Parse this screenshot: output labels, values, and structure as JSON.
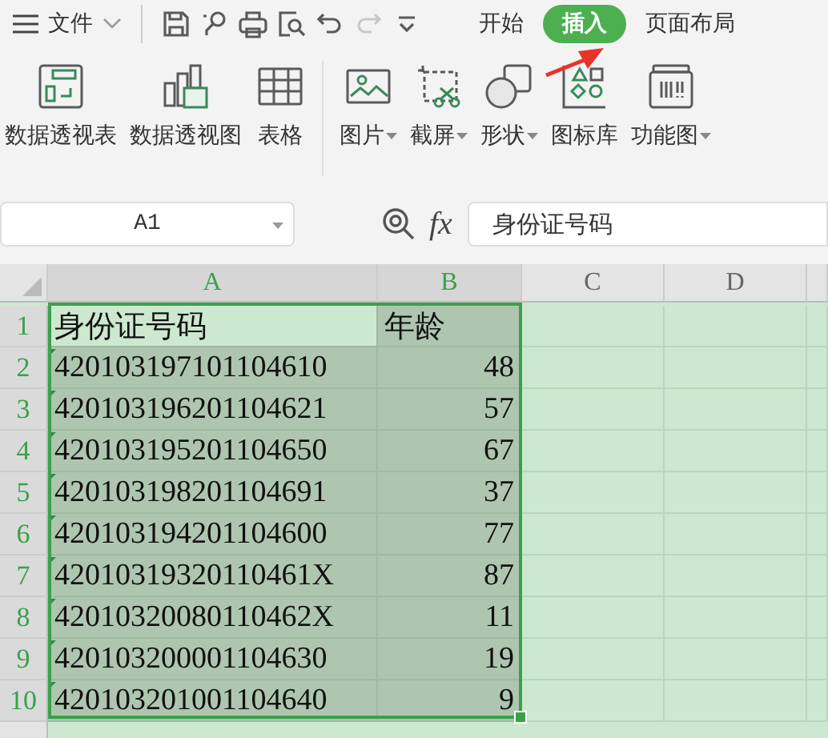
{
  "menu": {
    "label": "文件"
  },
  "tabs": [
    {
      "label": "开始",
      "selected": false
    },
    {
      "label": "插入",
      "selected": true
    },
    {
      "label": "页面布局",
      "selected": false
    }
  ],
  "ribbon": [
    {
      "kind": "pivot-table",
      "label": "数据透视表",
      "dropdown": false
    },
    {
      "kind": "pivot-chart",
      "label": "数据透视图",
      "dropdown": false
    },
    {
      "kind": "table",
      "label": "表格",
      "dropdown": false
    },
    {
      "kind": "picture",
      "label": "图片",
      "dropdown": true
    },
    {
      "kind": "screenshot",
      "label": "截屏",
      "dropdown": true
    },
    {
      "kind": "shape",
      "label": "形状",
      "dropdown": true
    },
    {
      "kind": "icon-library",
      "label": "图标库",
      "dropdown": false
    },
    {
      "kind": "function-chart",
      "label": "功能图",
      "dropdown": true
    }
  ],
  "name_box": {
    "value": "A1"
  },
  "formula_bar": {
    "fx_label": "fx",
    "value": "身份证号码"
  },
  "columns": [
    {
      "label": "A",
      "selected": true
    },
    {
      "label": "B",
      "selected": true
    },
    {
      "label": "C",
      "selected": false
    },
    {
      "label": "D",
      "selected": false
    }
  ],
  "rows": [
    {
      "number": "1",
      "selected": true,
      "cells": [
        {
          "text": "身份证号码",
          "kind": "text",
          "flag": false,
          "active": true
        },
        {
          "text": "年龄",
          "kind": "text",
          "flag": false,
          "active": false
        }
      ]
    },
    {
      "number": "2",
      "selected": true,
      "cells": [
        {
          "text": "420103197101104610",
          "kind": "text",
          "flag": true,
          "active": false
        },
        {
          "text": "48",
          "kind": "number",
          "flag": false,
          "active": false
        }
      ]
    },
    {
      "number": "3",
      "selected": true,
      "cells": [
        {
          "text": "420103196201104621",
          "kind": "text",
          "flag": true,
          "active": false
        },
        {
          "text": "57",
          "kind": "number",
          "flag": false,
          "active": false
        }
      ]
    },
    {
      "number": "4",
      "selected": true,
      "cells": [
        {
          "text": "420103195201104650",
          "kind": "text",
          "flag": true,
          "active": false
        },
        {
          "text": "67",
          "kind": "number",
          "flag": false,
          "active": false
        }
      ]
    },
    {
      "number": "5",
      "selected": true,
      "cells": [
        {
          "text": "420103198201104691",
          "kind": "text",
          "flag": true,
          "active": false
        },
        {
          "text": "37",
          "kind": "number",
          "flag": false,
          "active": false
        }
      ]
    },
    {
      "number": "6",
      "selected": true,
      "cells": [
        {
          "text": "420103194201104600",
          "kind": "text",
          "flag": true,
          "active": false
        },
        {
          "text": "77",
          "kind": "number",
          "flag": false,
          "active": false
        }
      ]
    },
    {
      "number": "7",
      "selected": true,
      "cells": [
        {
          "text": "42010319320110461X",
          "kind": "text",
          "flag": true,
          "active": false
        },
        {
          "text": "87",
          "kind": "number",
          "flag": false,
          "active": false
        }
      ]
    },
    {
      "number": "8",
      "selected": true,
      "cells": [
        {
          "text": "42010320080110462X",
          "kind": "text",
          "flag": true,
          "active": false
        },
        {
          "text": "11",
          "kind": "number",
          "flag": false,
          "active": false
        }
      ]
    },
    {
      "number": "9",
      "selected": true,
      "cells": [
        {
          "text": "420103200001104630",
          "kind": "text",
          "flag": true,
          "active": false
        },
        {
          "text": "19",
          "kind": "number",
          "flag": false,
          "active": false
        }
      ]
    },
    {
      "number": "10",
      "selected": true,
      "cells": [
        {
          "text": "420103201001104640",
          "kind": "text",
          "flag": true,
          "active": false
        },
        {
          "text": "9",
          "kind": "number",
          "flag": false,
          "active": false
        }
      ]
    }
  ]
}
